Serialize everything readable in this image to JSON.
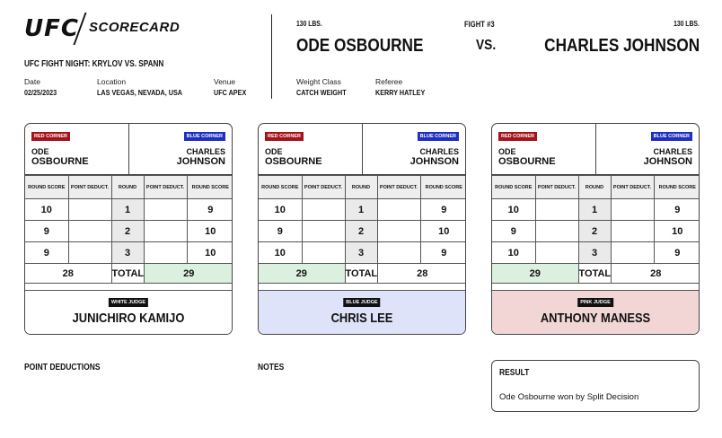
{
  "brand": {
    "logo": "UFC",
    "title": "SCORECARD"
  },
  "event": {
    "name": "UFC FIGHT NIGHT: KRYLOV VS. SPANN",
    "date_label": "Date",
    "date": "02/25/2023",
    "location_label": "Location",
    "location": "LAS VEGAS, NEVADA, USA",
    "venue_label": "Venue",
    "venue": "UFC APEX"
  },
  "fight": {
    "number": "FIGHT #3",
    "vs": "VS.",
    "red_weight": "130 LBS.",
    "blue_weight": "130 LBS.",
    "red_fighter": "ODE OSBOURNE",
    "blue_fighter": "CHARLES JOHNSON",
    "weight_class_label": "Weight Class",
    "weight_class": "CATCH WEIGHT",
    "referee_label": "Referee",
    "referee": "KERRY HATLEY"
  },
  "labels": {
    "red_corner": "RED CORNER",
    "blue_corner": "BLUE CORNER",
    "red_first": "ODE",
    "red_last": "OSBOURNE",
    "blue_first": "CHARLES",
    "blue_last": "JOHNSON",
    "round_score": "ROUND SCORE",
    "point_deduct": "POINT DEDUCT.",
    "round": "ROUND",
    "total": "TOTAL"
  },
  "cards": [
    {
      "judge_label": "WHITE JUDGE",
      "judge_name": "JUNICHIRO KAMIJO",
      "accent": "#ffffff",
      "winner": "blue",
      "rounds": [
        {
          "round": "1",
          "red": "10",
          "red_ded": "",
          "blue_ded": "",
          "blue": "9"
        },
        {
          "round": "2",
          "red": "9",
          "red_ded": "",
          "blue_ded": "",
          "blue": "10"
        },
        {
          "round": "3",
          "red": "9",
          "red_ded": "",
          "blue_ded": "",
          "blue": "10"
        }
      ],
      "red_total": "28",
      "blue_total": "29"
    },
    {
      "judge_label": "BLUE JUDGE",
      "judge_name": "CHRIS LEE",
      "accent": "#dfe3fa",
      "winner": "red",
      "rounds": [
        {
          "round": "1",
          "red": "10",
          "red_ded": "",
          "blue_ded": "",
          "blue": "9"
        },
        {
          "round": "2",
          "red": "9",
          "red_ded": "",
          "blue_ded": "",
          "blue": "10"
        },
        {
          "round": "3",
          "red": "10",
          "red_ded": "",
          "blue_ded": "",
          "blue": "9"
        }
      ],
      "red_total": "29",
      "blue_total": "28"
    },
    {
      "judge_label": "PINK JUDGE",
      "judge_name": "ANTHONY MANESS",
      "accent": "#f2d6d6",
      "winner": "red",
      "rounds": [
        {
          "round": "1",
          "red": "10",
          "red_ded": "",
          "blue_ded": "",
          "blue": "9"
        },
        {
          "round": "2",
          "red": "9",
          "red_ded": "",
          "blue_ded": "",
          "blue": "10"
        },
        {
          "round": "3",
          "red": "10",
          "red_ded": "",
          "blue_ded": "",
          "blue": "9"
        }
      ],
      "red_total": "29",
      "blue_total": "28"
    }
  ],
  "footer": {
    "point_deductions": "POINT DEDUCTIONS",
    "notes": "NOTES",
    "result_label": "RESULT",
    "result_text": "Ode Osbourne won by Split Decision"
  }
}
